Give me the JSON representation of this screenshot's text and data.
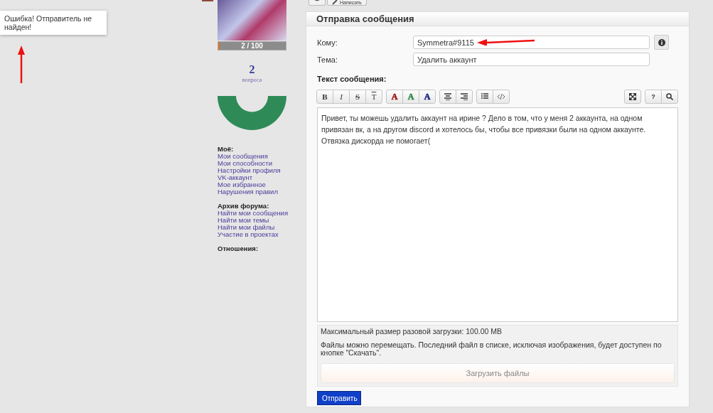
{
  "top_toolbar": {
    "button": "Написать"
  },
  "notification": {
    "text": "Ошибка! Отправитель не найден!"
  },
  "profile": {
    "progress": {
      "reading": "2 / 100",
      "level": 0.02
    },
    "count": "2",
    "count_label": "вопроса",
    "sections": [
      {
        "title": "Моё:",
        "links": [
          "Мои сообщения",
          "Мои способности",
          "Настройки профиля",
          "VK-аккаунт",
          "Мое избранное",
          "Нарушения правил"
        ]
      },
      {
        "title": "Архив форума:",
        "links": [
          "Найти мои сообщения",
          "Найти мои темы",
          "Найти мои файлы",
          "Участие в проектах"
        ]
      },
      {
        "title": "Отношения:"
      }
    ]
  },
  "form": {
    "title": "Отправка сообщения",
    "fields": [
      {
        "label": "Кому:",
        "value": "Symmetra#9115",
        "info": true
      },
      {
        "label": "Тема:",
        "value": "Удалить аккаунт",
        "info": false
      }
    ],
    "message_label": "Текст сообщения:",
    "toolbar": [
      [
        {
          "kind": "bold",
          "label": "B"
        },
        {
          "kind": "italic",
          "label": "I"
        },
        {
          "kind": "strike",
          "label": "S"
        },
        {
          "kind": "underline",
          "label": "T"
        }
      ],
      [
        {
          "kind": "color",
          "label": "A",
          "color": "#a01818"
        },
        {
          "kind": "color",
          "label": "A",
          "color": "#2a8a4a"
        },
        {
          "kind": "color",
          "label": "A",
          "color": "#1c2a8a"
        }
      ],
      [
        {
          "kind": "align-center"
        },
        {
          "kind": "align-right"
        }
      ],
      [
        {
          "kind": "list"
        },
        {
          "kind": "code"
        }
      ],
      [
        {
          "kind": "spacer"
        }
      ],
      [
        {
          "kind": "expand"
        }
      ],
      [
        {
          "kind": "help",
          "label": "?"
        },
        {
          "kind": "search"
        }
      ]
    ],
    "message": "Привет, ты можешь удалить аккаунт на ирине ? Дело в том, что у меня 2 аккаунта, на одном привязан вк, а на другом discord и хотелось бы, чтобы все привязки были на одном аккаунте. Отвязка дискорда не помогает(",
    "upload_limit": "Максимальный размер разовой загрузки: 100.00 MB",
    "upload_note": "Файлы можно перемещать. Последний файл в списке, исключая изображения, будет доступен по кнопке \"Скачать\".",
    "upload_button": "Загрузить файлы",
    "submit": "Отправить"
  }
}
